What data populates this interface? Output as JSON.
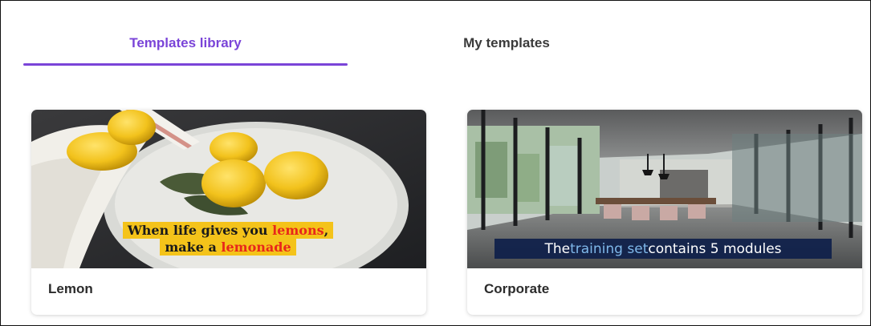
{
  "tabs": [
    {
      "label": "Templates library",
      "active": true
    },
    {
      "label": "My templates",
      "active": false
    }
  ],
  "accent_color": "#7a44d8",
  "templates": [
    {
      "name": "Lemon",
      "thumbnail_caption": {
        "line1_a": "When life gives you ",
        "line1_highlight": "lemons",
        "line1_b": ",",
        "line2_a": "make a ",
        "line2_highlight": "lemonade"
      },
      "caption_colors": {
        "background": "#f4c31a",
        "highlight": "#e8271b"
      }
    },
    {
      "name": "Corporate",
      "thumbnail_caption": {
        "text_a": "The ",
        "highlight": "training set",
        "text_b": " contains 5 modules"
      },
      "caption_colors": {
        "background": "#0e204a",
        "highlight": "#7fb8ea"
      }
    }
  ]
}
